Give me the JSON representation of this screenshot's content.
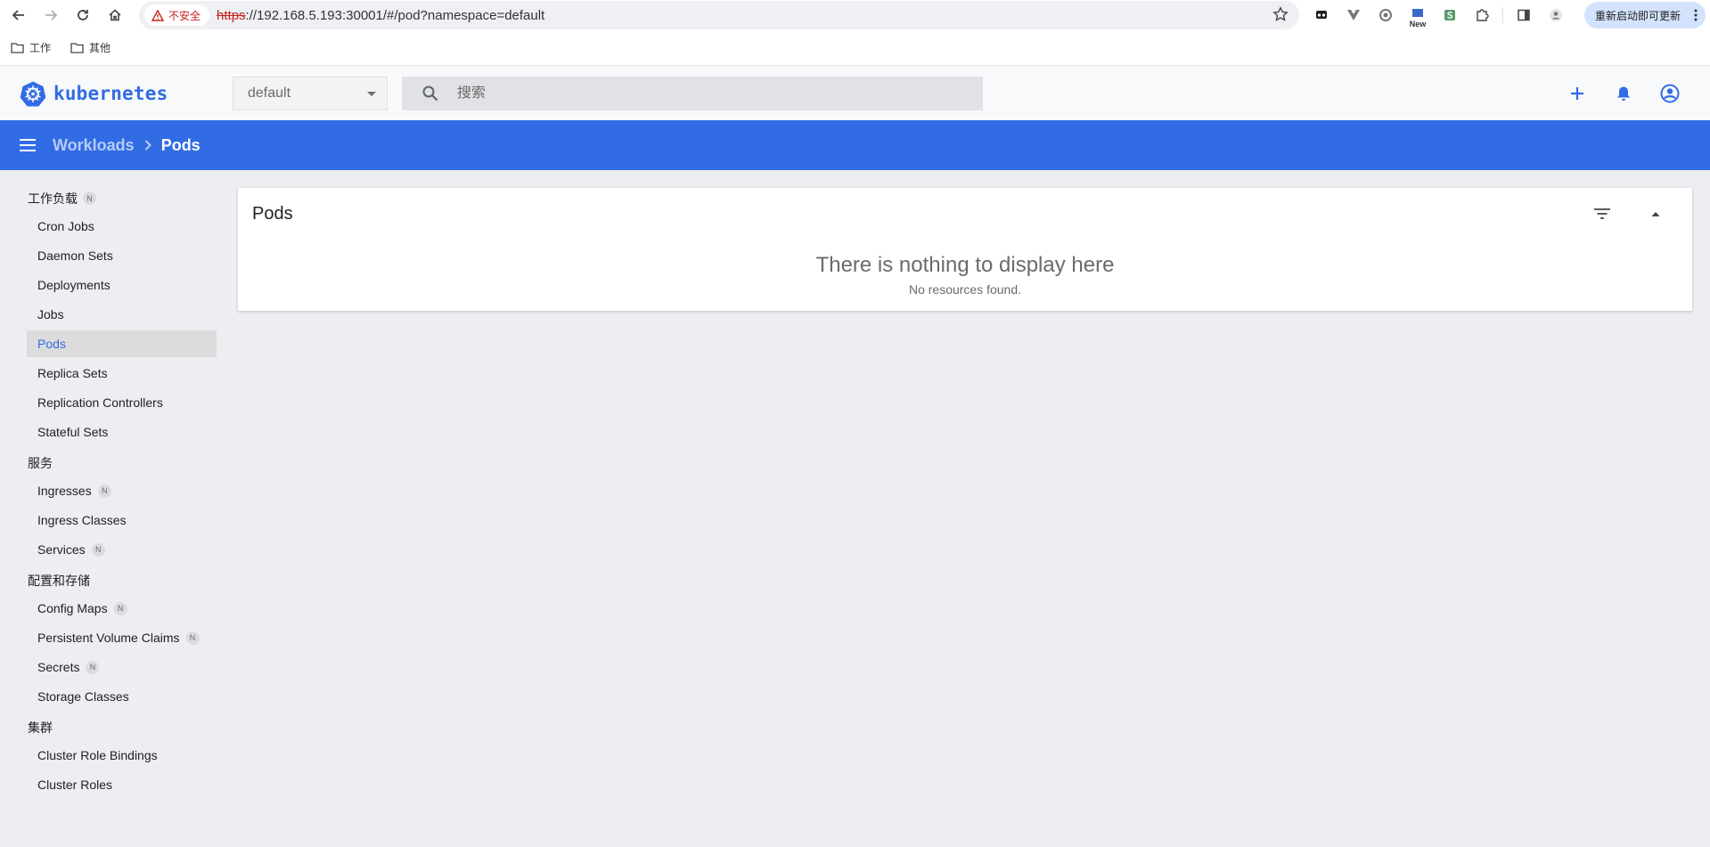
{
  "browser": {
    "security_label": "不安全",
    "url_scheme": "https",
    "url_rest": "://192.168.5.193:30001/#/pod?namespace=default",
    "ext_new_label": "New",
    "update_label": "重新启动即可更新",
    "bookmarks": [
      "工作",
      "其他"
    ]
  },
  "header": {
    "app_name": "kubernetes",
    "namespace": "default",
    "search_placeholder": "搜索"
  },
  "toolbar": {
    "breadcrumb_parent": "Workloads",
    "breadcrumb_current": "Pods"
  },
  "sidebar": {
    "groups": [
      {
        "label": "工作负载",
        "badge": "N",
        "items": [
          {
            "label": "Cron Jobs"
          },
          {
            "label": "Daemon Sets"
          },
          {
            "label": "Deployments"
          },
          {
            "label": "Jobs"
          },
          {
            "label": "Pods",
            "active": true
          },
          {
            "label": "Replica Sets"
          },
          {
            "label": "Replication Controllers"
          },
          {
            "label": "Stateful Sets"
          }
        ]
      },
      {
        "label": "服务",
        "items": [
          {
            "label": "Ingresses",
            "badge": "N"
          },
          {
            "label": "Ingress Classes"
          },
          {
            "label": "Services",
            "badge": "N"
          }
        ]
      },
      {
        "label": "配置和存储",
        "items": [
          {
            "label": "Config Maps",
            "badge": "N"
          },
          {
            "label": "Persistent Volume Claims",
            "badge": "N"
          },
          {
            "label": "Secrets",
            "badge": "N"
          },
          {
            "label": "Storage Classes"
          }
        ]
      },
      {
        "label": "集群",
        "items": [
          {
            "label": "Cluster Role Bindings"
          },
          {
            "label": "Cluster Roles"
          }
        ]
      }
    ]
  },
  "main": {
    "card_title": "Pods",
    "empty_title": "There is nothing to display here",
    "empty_subtitle": "No resources found."
  },
  "colors": {
    "brand": "#326ce5",
    "background": "#eceef1"
  }
}
